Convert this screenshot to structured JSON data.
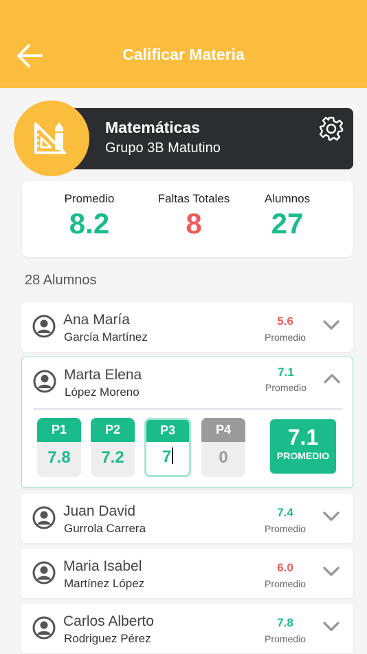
{
  "header": {
    "title": "Calificar Materia"
  },
  "subject": {
    "name": "Matemáticas",
    "group": "Grupo 3B Matutino"
  },
  "stats": [
    {
      "label": "Promedio",
      "value": "8.2"
    },
    {
      "label": "Faltas Totales",
      "value": "8"
    },
    {
      "label": "Alumnos",
      "value": "27"
    }
  ],
  "students_count_label": "28 Alumnos",
  "students": [
    {
      "first": "Ana María",
      "last": "García Martínez",
      "avg": "5.6",
      "avg_label": "Promedio"
    },
    {
      "first": "Marta Elena",
      "last": "López Moreno",
      "avg": "7.1",
      "avg_label": "Promedio",
      "periods": [
        {
          "label": "P1",
          "value": "7.8"
        },
        {
          "label": "P2",
          "value": "7.2"
        },
        {
          "label": "P3",
          "value": "7"
        },
        {
          "label": "P4",
          "value": "0"
        }
      ],
      "promedio_value": "7.1",
      "promedio_label": "PROMEDIO"
    },
    {
      "first": "Juan David",
      "last": "Gurrola Carrera",
      "avg": "7.4",
      "avg_label": "Promedio"
    },
    {
      "first": "Maria Isabel",
      "last": "Martínez López",
      "avg": "6.0",
      "avg_label": "Promedio"
    },
    {
      "first": "Carlos Alberto",
      "last": "Rodriguez Pérez",
      "avg": "7.8",
      "avg_label": "Promedio"
    }
  ],
  "colors": {
    "accent": "#fbbd3d",
    "dark": "#2b2d30",
    "green": "#1abc8c",
    "red": "#ef5b5b",
    "gray": "#9b9b9b"
  }
}
